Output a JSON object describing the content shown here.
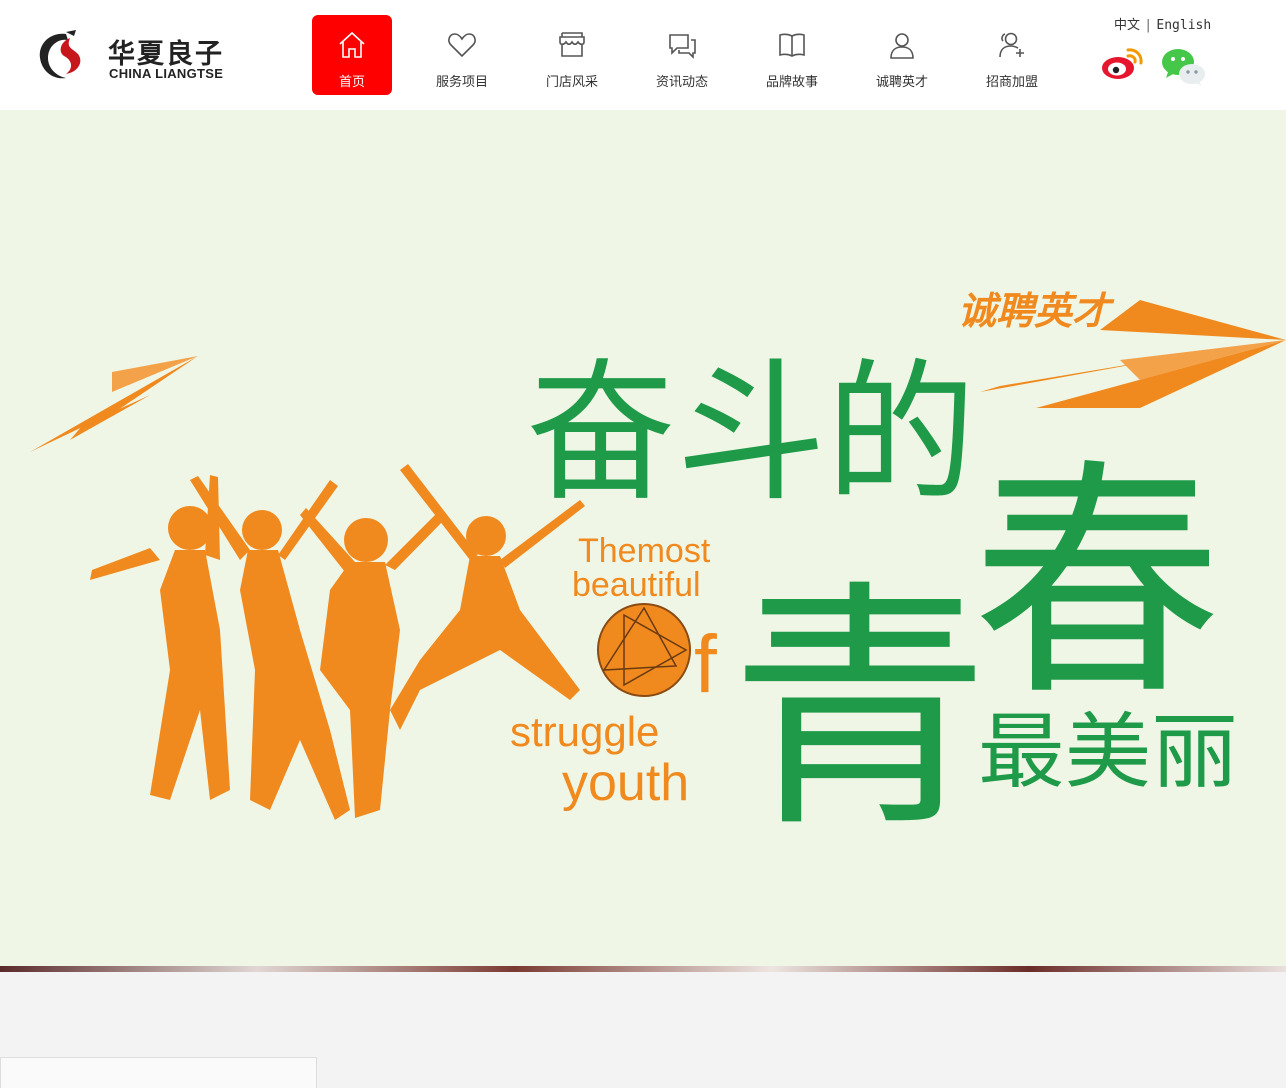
{
  "brand": {
    "name_cn": "华夏良子",
    "name_en": "CHINA LIANGTSE"
  },
  "nav": [
    {
      "label": "首页",
      "icon": "home-icon",
      "active": true
    },
    {
      "label": "服务项目",
      "icon": "heart-icon",
      "active": false
    },
    {
      "label": "门店风采",
      "icon": "store-icon",
      "active": false
    },
    {
      "label": "资讯动态",
      "icon": "chat-icon",
      "active": false
    },
    {
      "label": "品牌故事",
      "icon": "book-icon",
      "active": false
    },
    {
      "label": "诚聘英才",
      "icon": "user-icon",
      "active": false
    },
    {
      "label": "招商加盟",
      "icon": "user-add-icon",
      "active": false
    }
  ],
  "language": {
    "zh": "中文",
    "en": "English"
  },
  "social": [
    {
      "icon": "weibo-icon"
    },
    {
      "icon": "wechat-icon"
    }
  ],
  "banner": {
    "tag_cn": "诚聘英才",
    "headline_line1": "奋斗的",
    "headline_big1": "青",
    "headline_big2": "春",
    "headline_tail": "最美丽",
    "en_line1": "Themost",
    "en_line2": "beautiful",
    "en_line3": "f",
    "en_line4": "struggle",
    "en_line5": "youth"
  },
  "colors": {
    "accent": "#ff0000",
    "banner_bg": "#eff6e6",
    "green": "#1e9a48",
    "orange": "#f08a1e"
  }
}
